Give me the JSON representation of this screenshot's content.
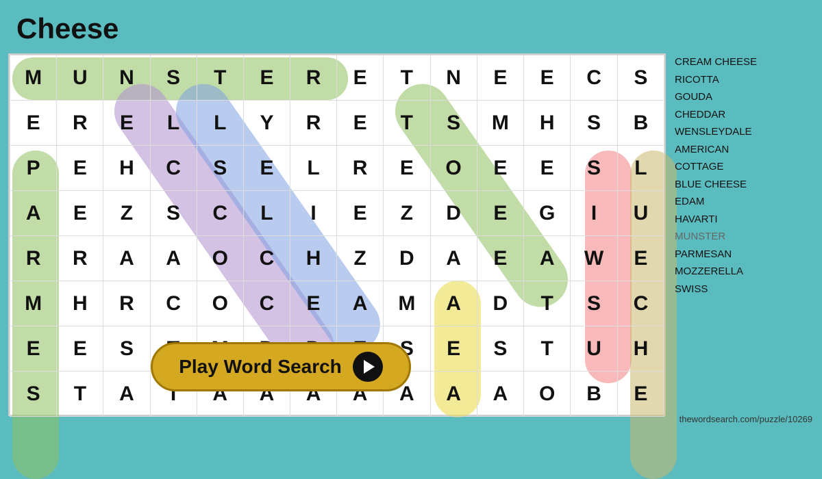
{
  "title": "Cheese",
  "grid": [
    [
      "M",
      "U",
      "N",
      "S",
      "T",
      "E",
      "R",
      "E",
      "T",
      "N",
      "E",
      "E",
      "C",
      "S"
    ],
    [
      "E",
      "R",
      "E",
      "L",
      "L",
      "Y",
      "R",
      "E",
      "T",
      "S",
      "M",
      "H",
      "S",
      "B"
    ],
    [
      "P",
      "E",
      "H",
      "C",
      "S",
      "E",
      "L",
      "R",
      "E",
      "O",
      "E",
      "E",
      "S",
      "L"
    ],
    [
      "A",
      "E",
      "Z",
      "S",
      "C",
      "L",
      "I",
      "E",
      "Z",
      "D",
      "E",
      "G",
      "I",
      "U"
    ],
    [
      "R",
      "R",
      "A",
      "A",
      "O",
      "C",
      "H",
      "Z",
      "D",
      "A",
      "E",
      "A",
      "W",
      "E"
    ],
    [
      "M",
      "H",
      "R",
      "C",
      "O",
      "C",
      "E",
      "A",
      "M",
      "A",
      "D",
      "T",
      "S",
      "C"
    ],
    [
      "E",
      "E",
      "S",
      "T",
      "M",
      "D",
      "D",
      "E",
      "S",
      "E",
      "S",
      "T",
      "U",
      "H"
    ],
    [
      "S",
      "T",
      "A",
      "T",
      "A",
      "A",
      "A",
      "A",
      "A",
      "A",
      "A",
      "O",
      "B",
      "E"
    ]
  ],
  "words": [
    {
      "label": "CREAM CHEESE",
      "found": false
    },
    {
      "label": "RICOTTA",
      "found": false
    },
    {
      "label": "GOUDA",
      "found": false
    },
    {
      "label": "CHEDDAR",
      "found": false
    },
    {
      "label": "WENSLEYDALE",
      "found": false
    },
    {
      "label": "AMERICAN",
      "found": false
    },
    {
      "label": "COTTAGE",
      "found": false
    },
    {
      "label": "BLUE CHEESE",
      "found": false
    },
    {
      "label": "EDAM",
      "found": false
    },
    {
      "label": "HAVARTI",
      "found": false
    },
    {
      "label": "MUNSTER",
      "found": true
    },
    {
      "label": "PARMESAN",
      "found": false
    },
    {
      "label": "MOZZERELLA",
      "found": false
    },
    {
      "label": "SWISS",
      "found": false
    }
  ],
  "play_button": {
    "label": "Play Word Search"
  },
  "url": "thewordsearch.com/puzzle/10269"
}
